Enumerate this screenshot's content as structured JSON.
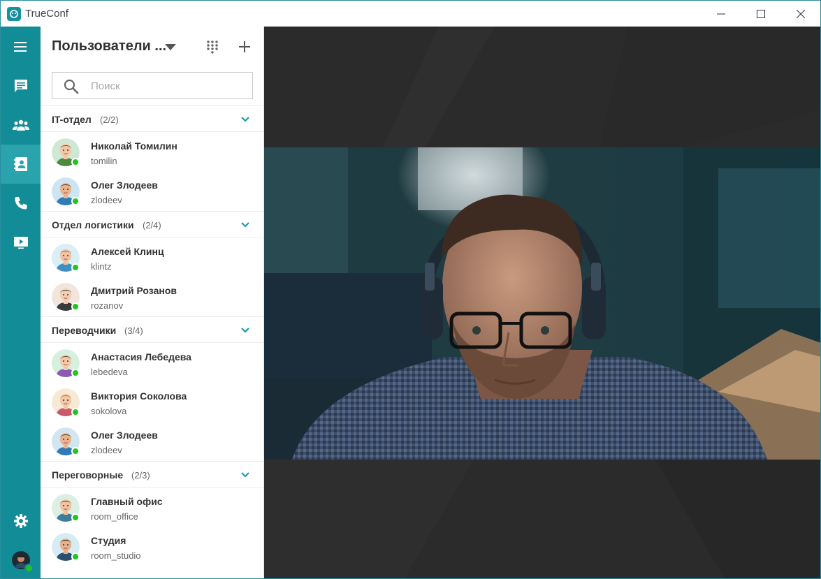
{
  "app": {
    "title": "TrueConf",
    "logo_icon": "trueconf-logo-icon"
  },
  "window_controls": {
    "minimize_icon": "minimize-icon",
    "maximize_icon": "maximize-icon",
    "close_icon": "close-icon"
  },
  "nav": {
    "items": [
      {
        "icon": "hamburger-menu-icon"
      },
      {
        "icon": "chat-icon"
      },
      {
        "icon": "group-icon"
      },
      {
        "icon": "address-book-icon",
        "active": true
      },
      {
        "icon": "phone-icon"
      },
      {
        "icon": "presentation-icon"
      }
    ],
    "settings_icon": "gear-icon",
    "user_avatar_status": "online"
  },
  "panel": {
    "title": "Пользователи ...",
    "dropdown_icon": "caret-down-icon",
    "dialpad_icon": "dialpad-icon",
    "add_icon": "plus-icon",
    "search": {
      "placeholder": "Поиск",
      "value": ""
    }
  },
  "groups": [
    {
      "name": "IT-отдел",
      "count": "(2/2)",
      "contacts": [
        {
          "name": "Николай Томилин",
          "login": "tomilin",
          "status": "online"
        },
        {
          "name": "Олег Злодеев",
          "login": "zlodeev",
          "status": "online"
        }
      ]
    },
    {
      "name": "Отдел логистики",
      "count": "(2/4)",
      "contacts": [
        {
          "name": "Алексей Клинц",
          "login": "klintz",
          "status": "online"
        },
        {
          "name": "Дмитрий Розанов",
          "login": "rozanov",
          "status": "online"
        }
      ]
    },
    {
      "name": "Переводчики",
      "count": "(3/4)",
      "contacts": [
        {
          "name": "Анастасия Лебедева",
          "login": "lebedeva",
          "status": "online"
        },
        {
          "name": "Виктория Соколова",
          "login": "sokolova",
          "status": "online"
        },
        {
          "name": "Олег Злодеев",
          "login": "zlodeev",
          "status": "online"
        }
      ]
    },
    {
      "name": "Переговорные",
      "count": "(2/3)",
      "contacts": [
        {
          "name": "Главный офис",
          "login": "room_office",
          "status": "online"
        },
        {
          "name": "Студия",
          "login": "room_studio",
          "status": "online"
        }
      ]
    }
  ],
  "colors": {
    "accent": "#128d98",
    "accent_active": "#2aa3ad",
    "online": "#22c322",
    "stage_bg": "#2b2b2b"
  }
}
